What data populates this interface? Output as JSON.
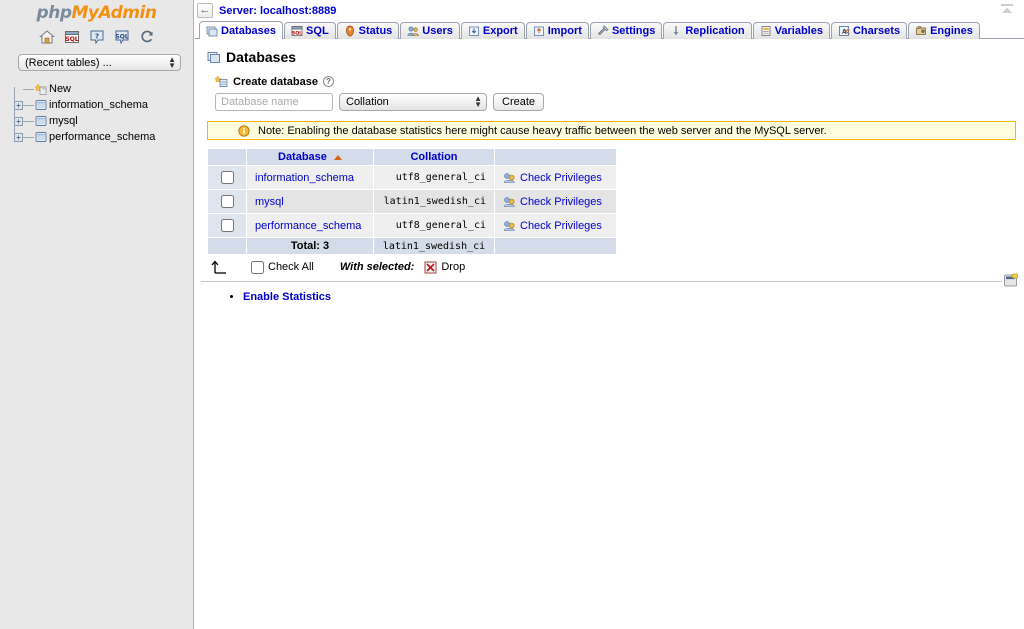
{
  "sidebar": {
    "logo": {
      "part1": "php",
      "part2": "MyAdmin"
    },
    "icons": [
      {
        "name": "home-icon",
        "title": "Home"
      },
      {
        "name": "sql-query-icon",
        "title": "Query window"
      },
      {
        "name": "help-icon",
        "title": "phpMyAdmin documentation"
      },
      {
        "name": "docs-icon",
        "title": "Documentation"
      },
      {
        "name": "reload-icon",
        "title": "Reload navigation"
      }
    ],
    "recent_select": {
      "value": "(Recent tables) ...",
      "options": [
        "(Recent tables) ..."
      ]
    },
    "tree": [
      {
        "label": "New",
        "icon": "new-icon",
        "expandable": false
      },
      {
        "label": "information_schema",
        "icon": "database-icon",
        "expandable": true
      },
      {
        "label": "mysql",
        "icon": "database-icon",
        "expandable": true
      },
      {
        "label": "performance_schema",
        "icon": "database-icon",
        "expandable": true
      }
    ]
  },
  "header": {
    "back_label": "←",
    "server_title": "Server: localhost:8889",
    "collapse_title": "Collapse"
  },
  "tabs": [
    {
      "label": "Databases",
      "icon": "databases-icon",
      "active": true
    },
    {
      "label": "SQL",
      "icon": "sql-icon",
      "active": false
    },
    {
      "label": "Status",
      "icon": "status-icon",
      "active": false
    },
    {
      "label": "Users",
      "icon": "users-icon",
      "active": false
    },
    {
      "label": "Export",
      "icon": "export-icon",
      "active": false
    },
    {
      "label": "Import",
      "icon": "import-icon",
      "active": false
    },
    {
      "label": "Settings",
      "icon": "settings-icon",
      "active": false
    },
    {
      "label": "Replication",
      "icon": "replication-icon",
      "active": false
    },
    {
      "label": "Variables",
      "icon": "variables-icon",
      "active": false
    },
    {
      "label": "Charsets",
      "icon": "charsets-icon",
      "active": false
    },
    {
      "label": "Engines",
      "icon": "engines-icon",
      "active": false
    }
  ],
  "page": {
    "title": "Databases",
    "create": {
      "heading": "Create database",
      "help_glyph": "?",
      "name_placeholder": "Database name",
      "name_value": "",
      "collation_value": "Collation",
      "collation_options": [
        "Collation"
      ],
      "create_button": "Create"
    },
    "note": "Note: Enabling the database statistics here might cause heavy traffic between the web server and the MySQL server.",
    "table": {
      "columns": [
        "Database",
        "Collation"
      ],
      "sort_column": "Database",
      "sort_direction": "asc",
      "privileges_label": "Check Privileges",
      "rows": [
        {
          "database": "information_schema",
          "collation": "utf8_general_ci",
          "checked": false
        },
        {
          "database": "mysql",
          "collation": "latin1_swedish_ci",
          "checked": false
        },
        {
          "database": "performance_schema",
          "collation": "utf8_general_ci",
          "checked": false
        }
      ],
      "total_label": "Total: 3",
      "total_collation": "latin1_swedish_ci"
    },
    "actions": {
      "check_all": "Check All",
      "with_selected": "With selected:",
      "drop": "Drop"
    },
    "statistics_link": "Enable Statistics"
  },
  "colors": {
    "link": "#0000cc",
    "accent_orange": "#f29111",
    "note_border": "#ffb300",
    "note_bg": "#ffffdd",
    "header_bg": "#d3dce8",
    "row_odd": "#efefef",
    "row_even": "#e4e4e4",
    "sidebar_bg": "#e8e8e8"
  }
}
